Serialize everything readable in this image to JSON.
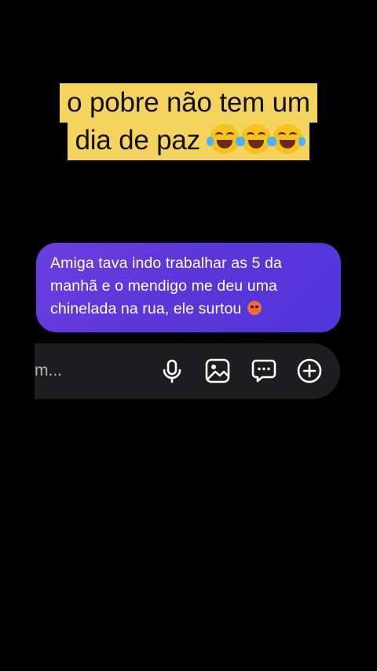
{
  "caption": {
    "line1": "o pobre não tem um",
    "line2": "dia de paz",
    "emoji_icon": "face-with-tears-of-joy-icon",
    "emoji_count": 3,
    "background": "#f4d35e"
  },
  "message": {
    "line1": "Amiga tava indo trabalhar as 5 da",
    "line2": "manhã e o mendigo me deu uma",
    "line3": "chinelada na rua, ele surtou",
    "emoji_icon": "angry-face-icon",
    "bubble_color": "#5b35d8"
  },
  "composer": {
    "placeholder": "m...",
    "icons": [
      "microphone-icon",
      "image-icon",
      "message-icon",
      "plus-icon"
    ]
  }
}
